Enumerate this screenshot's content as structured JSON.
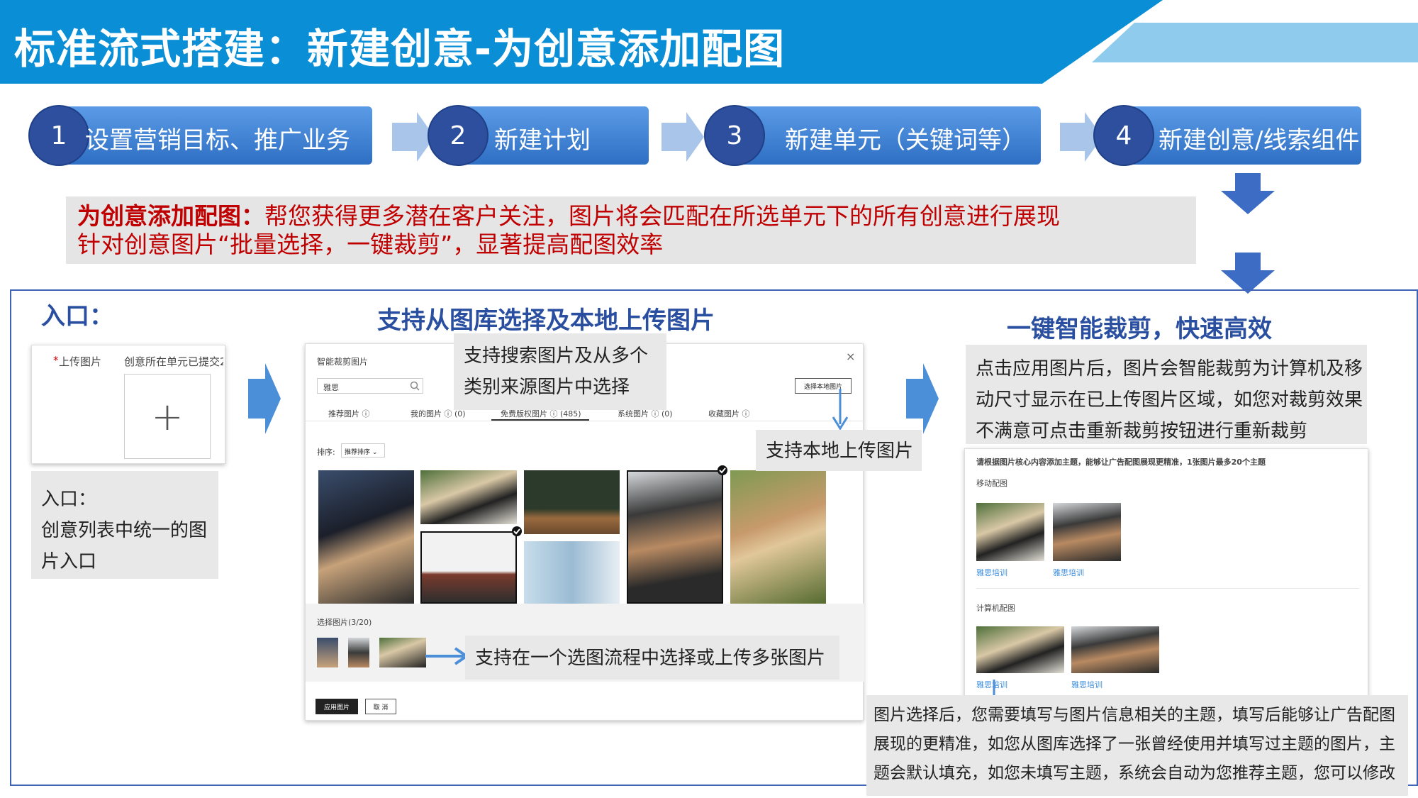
{
  "header": {
    "title": "标准流式搭建：新建创意-为创意添加配图"
  },
  "steps": [
    {
      "num": "1",
      "label": "设置营销目标、推广业务"
    },
    {
      "num": "2",
      "label": "新建计划"
    },
    {
      "num": "3",
      "label": "新建单元（关键词等）"
    },
    {
      "num": "4",
      "label": "新建创意/线索组件"
    }
  ],
  "desc": {
    "lead": "为创意添加配图：",
    "line1": "帮您获得更多潜在客户关注，图片将会匹配在所选单元下的所有创意进行展现",
    "line2": "针对创意图片“批量选择，一键裁剪”，显著提高配图效率"
  },
  "entry": {
    "title": "入口：",
    "upload_label": "上传图片",
    "upload_required": "*",
    "upload_note": "创意所在单元已提交2",
    "plus": "+",
    "note_title": "入口：",
    "note_line1": "创意列表中统一的图",
    "note_line2": "片入口"
  },
  "library": {
    "title": "支持从图库选择及本地上传图片",
    "panel_title": "智能裁剪图片",
    "close": "×",
    "search_value": "雅思",
    "local_upload_btn": "选择本地图片",
    "tabs": [
      "推荐图片 ⓘ",
      "我的图片 ⓘ (0)",
      "免费版权图片 ⓘ (485)",
      "系统图片 ⓘ (0)",
      "收藏图片 ⓘ"
    ],
    "sort_label": "排序:",
    "sort_value": "推荐排序",
    "selected_label": "选择图片(3/20)",
    "apply_btn": "应用图片",
    "cancel_btn": "取 消",
    "callout_search_line1": "支持搜索图片及从多个",
    "callout_search_line2": "类别来源图片中选择",
    "callout_local": "支持本地上传图片",
    "callout_multi": "支持在一个选图流程中选择或上传多张图片"
  },
  "crop": {
    "title": "一键智能裁剪，快速高效",
    "callout_line1": "点击应用图片后，图片会智能裁剪为计算机及移",
    "callout_line2": "动尺寸显示在已上传图片区域，如您对裁剪效果",
    "callout_line3": "不满意可点击重新裁剪按钮进行重新裁剪",
    "panel_note": "请根据图片核心内容添加主题，能够让广告配图展现更精准，1张图片最多20个主题",
    "mobile_label": "移动配图",
    "pc_label": "计算机配图",
    "topic": "雅思培训",
    "bottom_line1": "图片选择后，您需要填写与图片信息相关的主题，填写后能够让广告配图",
    "bottom_line2": "展现的更精准，如您从图库选择了一张曾经使用并填写过主题的图片，主",
    "bottom_line3": "题会默认填充，如您未填写主题，系统会自动为您推荐主题，您可以修改"
  },
  "colors": {
    "header_blue": "#0a8fd6",
    "light_blue": "#8ecbec",
    "step_blue": "#3b7fd4",
    "circle_navy": "#2d4f9e",
    "title_navy": "#2a4fa0",
    "alert_red": "#c00000",
    "arrow_blue": "#4b8fd8",
    "down_arrow": "#3d6cc4"
  }
}
